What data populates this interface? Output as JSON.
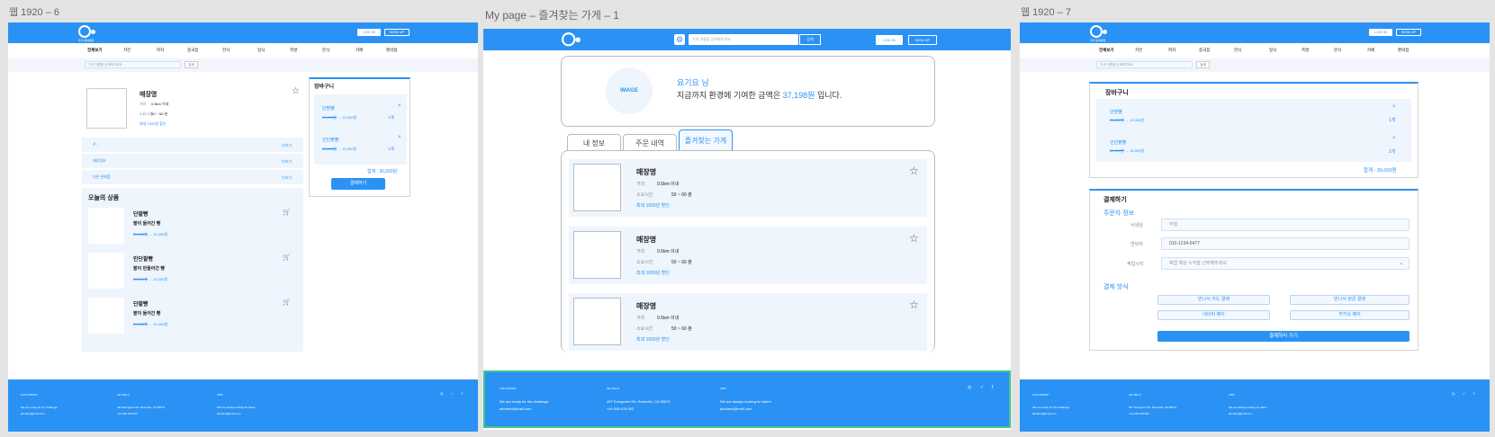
{
  "frames": {
    "left": "웹 1920 – 6",
    "middle": "My page – 즐겨찾는 가게 – 1",
    "right": "웹 1920 – 7"
  },
  "header": {
    "brand_sub": "우리 동네빵집",
    "login": "LOG IN",
    "signup": "SIGN UP",
    "search_placeholder": "가게 이름을 검색해주세요",
    "search_button": "검색"
  },
  "nav": [
    "전체보기",
    "치킨",
    "피자",
    "중국집",
    "한식",
    "일식",
    "족발",
    "분식",
    "카페",
    "편의점"
  ],
  "store": {
    "name": "매장명",
    "dist_label": "거리",
    "dist": "0.5km 이내",
    "time_label": "소요시간",
    "time": "50 ~ 60 분",
    "discount": "최대 1000원 할인"
  },
  "info_rows": [
    {
      "label": "주...",
      "action": "더보기"
    },
    {
      "label": "매장정보",
      "action": "더보기"
    },
    {
      "label": "다른 판매품",
      "action": "더보기"
    }
  ],
  "today": {
    "title": "오늘의 상품",
    "items": [
      {
        "name": "단팥빵",
        "desc": "팥이 들어간 빵",
        "old": "20,000원",
        "arrow": "→",
        "new": "15,000원"
      },
      {
        "name": "인단팥빵",
        "desc": "팥이 반들어간 빵",
        "old": "20,000원",
        "arrow": "→",
        "new": "15,000원"
      },
      {
        "name": "단팥빵",
        "desc": "팥이 들어간 빵",
        "old": "20,000원",
        "arrow": "→",
        "new": "15,000원"
      }
    ]
  },
  "cart": {
    "title": "장바구니",
    "items": [
      {
        "name": "단팥빵",
        "old": "20,000원",
        "arrow": "→",
        "new": "15,000원",
        "qty": "1개"
      },
      {
        "name": "인단팥빵",
        "old": "20,000원",
        "arrow": "→",
        "new": "15,000원",
        "qty": "1개"
      }
    ],
    "total": "합계 : 30,000원",
    "checkout": "결제하기"
  },
  "mypage": {
    "image_label": "IMAGE",
    "greeting": "요기요 님",
    "contrib_prefix": "지금까지 환경에 기여한 금액은 ",
    "contrib_amount": "37,198원",
    "contrib_suffix": " 입니다.",
    "tabs": [
      "내 정보",
      "주문 내역",
      "즐겨찾는 가게"
    ]
  },
  "footer": {
    "cols": [
      {
        "title": "OUR COMPANY",
        "line1": "We are ready for the challenge",
        "line2": "abcdeed@mail.com"
      },
      {
        "title": "GET HELLO",
        "line1": "497 Evergreen Rd. Roseville, CA 95673",
        "line2": "+44 345 678 903"
      },
      {
        "title": "JOBS",
        "line1": "We are always looking for talent",
        "line2": "abcdeed@mail.com"
      }
    ],
    "social": [
      "◎",
      "✓",
      "f"
    ]
  },
  "checkout": {
    "title": "결제하기",
    "orderer": "주문자 정보",
    "fields": [
      {
        "label": "닉네임",
        "value": "쭈얼"
      },
      {
        "label": "연락처",
        "value": "010-1234-6477"
      },
      {
        "label": "픽업시각",
        "value": "픽업 예상 시각을 선택해주세요"
      }
    ],
    "pay_title": "결제 방식",
    "pay": [
      "만나서 카드 결제",
      "만나서 현금 결제",
      "네이버 페이",
      "카카오 페이"
    ],
    "go": "결제하러 가기"
  }
}
